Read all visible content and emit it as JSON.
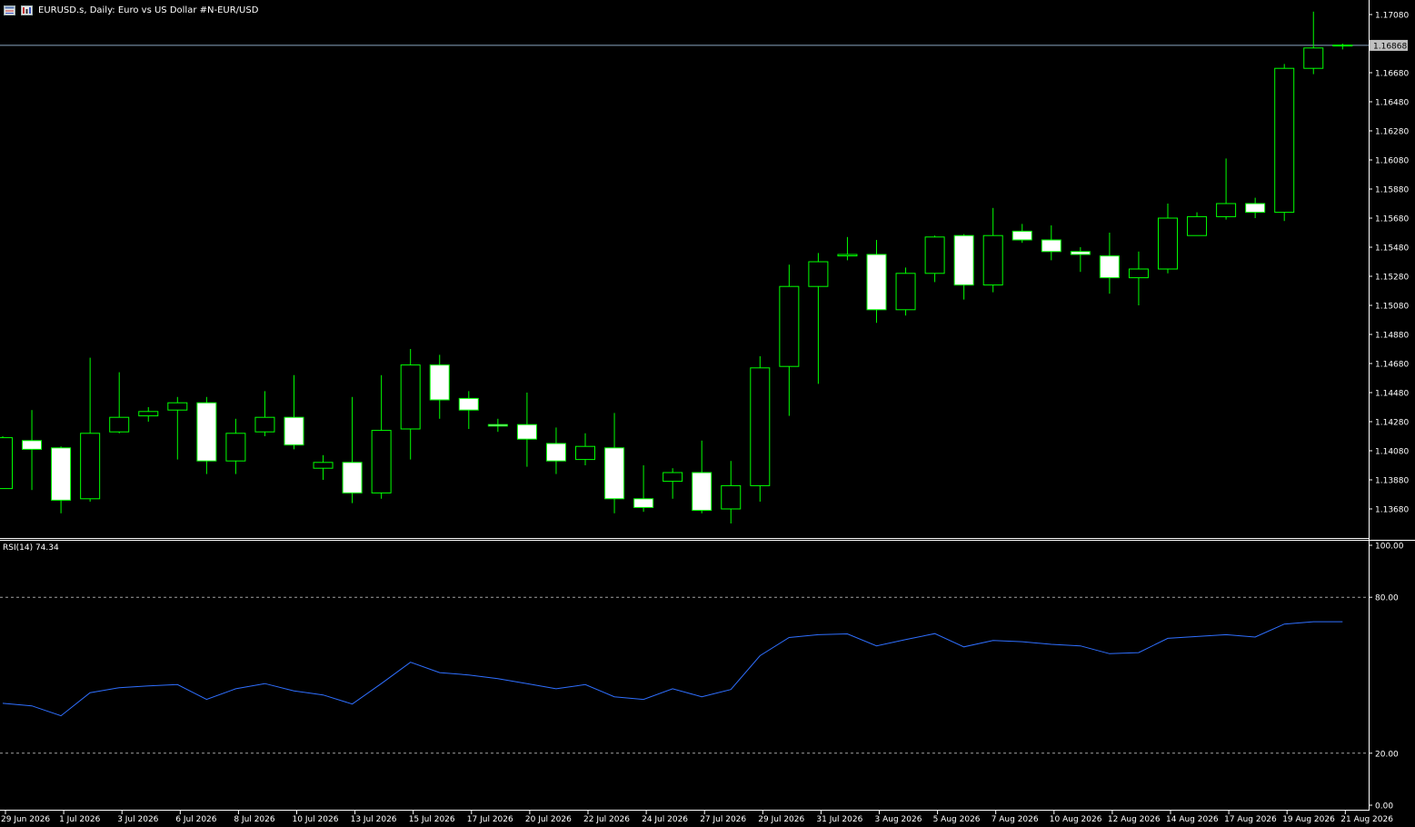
{
  "header": {
    "title": "EURUSD.s, Daily:  Euro vs US Dollar #N-EUR/USD",
    "icons": [
      "chart-window-icon",
      "chart-properties-icon"
    ]
  },
  "colors": {
    "background": "#000000",
    "candle_outline": "#00ff00",
    "candle_bull_fill": "#000000",
    "candle_bear_fill": "#ffffff",
    "grid_axis": "#ffffff",
    "price_line": "#8aa6c1",
    "price_label_bg": "#c0c0c0",
    "rsi_line": "#2f6fff",
    "rsi_levels": "#a0a0a0"
  },
  "price_axis": {
    "min": 1.1358,
    "max": 1.1718,
    "ticks": [
      "1.17080",
      "1.16680",
      "1.16480",
      "1.16280",
      "1.16080",
      "1.15880",
      "1.15680",
      "1.15480",
      "1.15280",
      "1.15080",
      "1.14880",
      "1.14680",
      "1.14480",
      "1.14280",
      "1.14080",
      "1.13880",
      "1.13680"
    ],
    "current_price_label": "1.16868",
    "current_price": 1.16868
  },
  "rsi": {
    "label": "RSI(14) 74.34",
    "axis_ticks": [
      "100.00",
      "80.00",
      "20.00",
      "0.00"
    ],
    "levels": [
      80,
      20
    ],
    "values": [
      39.2,
      38.2,
      34.4,
      43.3,
      45.2,
      45.9,
      46.4,
      40.7,
      44.8,
      46.8,
      44.0,
      42.4,
      38.9,
      46.8,
      55.0,
      51.0,
      50.1,
      48.7,
      46.8,
      44.8,
      46.4,
      41.7,
      40.7,
      44.8,
      41.7,
      44.5,
      57.5,
      64.5,
      65.6,
      65.9,
      61.3,
      63.7,
      66.0,
      60.9,
      63.4,
      62.9,
      61.9,
      61.3,
      58.3,
      58.7,
      64.2,
      64.9,
      65.6,
      64.7,
      69.7,
      70.6,
      70.6
    ]
  },
  "x_axis": {
    "dates": [
      "29 Jun 2026",
      "1 Jul 2026",
      "3 Jul 2026",
      "6 Jul 2026",
      "8 Jul 2026",
      "10 Jul 2026",
      "13 Jul 2026",
      "15 Jul 2026",
      "17 Jul 2026",
      "20 Jul 2026",
      "22 Jul 2026",
      "24 Jul 2026",
      "27 Jul 2026",
      "29 Jul 2026",
      "31 Jul 2026",
      "3 Aug 2026",
      "5 Aug 2026",
      "7 Aug 2026",
      "10 Aug 2026",
      "12 Aug 2026",
      "14 Aug 2026",
      "17 Aug 2026",
      "19 Aug 2026",
      "21 Aug 2026"
    ]
  },
  "chart_data": {
    "type": "candlestick",
    "symbol": "EURUSD.s",
    "timeframe": "Daily",
    "candles": [
      {
        "o": 1.1382,
        "h": 1.1418,
        "l": 1.1382,
        "c": 1.1417
      },
      {
        "o": 1.1415,
        "h": 1.1436,
        "l": 1.1381,
        "c": 1.1409
      },
      {
        "o": 1.141,
        "h": 1.1411,
        "l": 1.1365,
        "c": 1.1374
      },
      {
        "o": 1.1375,
        "h": 1.1472,
        "l": 1.1373,
        "c": 1.142
      },
      {
        "o": 1.1421,
        "h": 1.1462,
        "l": 1.142,
        "c": 1.1431
      },
      {
        "o": 1.1432,
        "h": 1.1438,
        "l": 1.1428,
        "c": 1.1435
      },
      {
        "o": 1.1436,
        "h": 1.1445,
        "l": 1.1402,
        "c": 1.1441
      },
      {
        "o": 1.1441,
        "h": 1.1445,
        "l": 1.1392,
        "c": 1.1401
      },
      {
        "o": 1.1401,
        "h": 1.143,
        "l": 1.1392,
        "c": 1.142
      },
      {
        "o": 1.1421,
        "h": 1.1449,
        "l": 1.1418,
        "c": 1.1431
      },
      {
        "o": 1.1431,
        "h": 1.146,
        "l": 1.1409,
        "c": 1.1412
      },
      {
        "o": 1.1396,
        "h": 1.1405,
        "l": 1.1388,
        "c": 1.14
      },
      {
        "o": 1.14,
        "h": 1.1445,
        "l": 1.1372,
        "c": 1.1379
      },
      {
        "o": 1.1379,
        "h": 1.146,
        "l": 1.1375,
        "c": 1.1422
      },
      {
        "o": 1.1423,
        "h": 1.1478,
        "l": 1.1402,
        "c": 1.1467
      },
      {
        "o": 1.1467,
        "h": 1.1474,
        "l": 1.143,
        "c": 1.1443
      },
      {
        "o": 1.1444,
        "h": 1.1449,
        "l": 1.1423,
        "c": 1.1436
      },
      {
        "o": 1.1426,
        "h": 1.143,
        "l": 1.1421,
        "c": 1.1425
      },
      {
        "o": 1.1426,
        "h": 1.1448,
        "l": 1.1397,
        "c": 1.1416
      },
      {
        "o": 1.1413,
        "h": 1.1424,
        "l": 1.1392,
        "c": 1.1401
      },
      {
        "o": 1.1402,
        "h": 1.142,
        "l": 1.1398,
        "c": 1.1411
      },
      {
        "o": 1.141,
        "h": 1.1434,
        "l": 1.1365,
        "c": 1.1375
      },
      {
        "o": 1.1375,
        "h": 1.1398,
        "l": 1.1366,
        "c": 1.1369
      },
      {
        "o": 1.1387,
        "h": 1.1396,
        "l": 1.1375,
        "c": 1.1393
      },
      {
        "o": 1.1393,
        "h": 1.1415,
        "l": 1.1365,
        "c": 1.1367
      },
      {
        "o": 1.1368,
        "h": 1.1401,
        "l": 1.1358,
        "c": 1.1384
      },
      {
        "o": 1.1384,
        "h": 1.1473,
        "l": 1.1373,
        "c": 1.1465
      },
      {
        "o": 1.1466,
        "h": 1.1536,
        "l": 1.1432,
        "c": 1.1521
      },
      {
        "o": 1.1521,
        "h": 1.1544,
        "l": 1.1454,
        "c": 1.1538
      },
      {
        "o": 1.1542,
        "h": 1.1555,
        "l": 1.1539,
        "c": 1.1543
      },
      {
        "o": 1.1543,
        "h": 1.1553,
        "l": 1.1496,
        "c": 1.1505
      },
      {
        "o": 1.1505,
        "h": 1.1534,
        "l": 1.1501,
        "c": 1.153
      },
      {
        "o": 1.153,
        "h": 1.1556,
        "l": 1.1524,
        "c": 1.1555
      },
      {
        "o": 1.1556,
        "h": 1.1557,
        "l": 1.1512,
        "c": 1.1522
      },
      {
        "o": 1.1522,
        "h": 1.1575,
        "l": 1.1517,
        "c": 1.1556
      },
      {
        "o": 1.1559,
        "h": 1.1564,
        "l": 1.1551,
        "c": 1.1553
      },
      {
        "o": 1.1553,
        "h": 1.1563,
        "l": 1.1539,
        "c": 1.1545
      },
      {
        "o": 1.1545,
        "h": 1.1548,
        "l": 1.1531,
        "c": 1.1543
      },
      {
        "o": 1.1542,
        "h": 1.1558,
        "l": 1.1516,
        "c": 1.1527
      },
      {
        "o": 1.1527,
        "h": 1.1545,
        "l": 1.1508,
        "c": 1.1533
      },
      {
        "o": 1.1533,
        "h": 1.1578,
        "l": 1.153,
        "c": 1.1568
      },
      {
        "o": 1.1556,
        "h": 1.1572,
        "l": 1.1556,
        "c": 1.1569
      },
      {
        "o": 1.1569,
        "h": 1.1609,
        "l": 1.1567,
        "c": 1.1578
      },
      {
        "o": 1.1578,
        "h": 1.1582,
        "l": 1.1568,
        "c": 1.1572
      },
      {
        "o": 1.1572,
        "h": 1.1674,
        "l": 1.1566,
        "c": 1.1671
      },
      {
        "o": 1.1671,
        "h": 1.171,
        "l": 1.1667,
        "c": 1.1685
      },
      {
        "o": 1.1687,
        "h": 1.1688,
        "l": 1.1684,
        "c": 1.1687
      }
    ]
  }
}
